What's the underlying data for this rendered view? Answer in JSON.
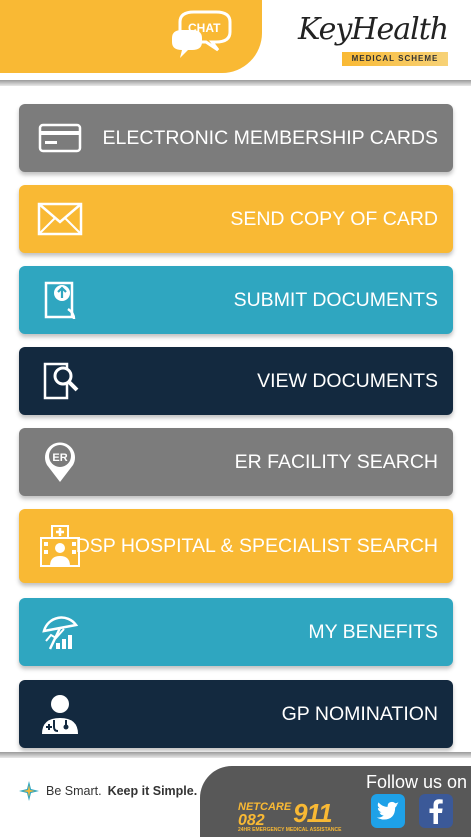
{
  "header": {
    "chat_label": "CHAT",
    "logo_title": "KeyHealth",
    "logo_subtitle": "MEDICAL SCHEME"
  },
  "menu": [
    {
      "label": "ELECTRONIC MEMBERSHIP CARDS",
      "color": "#7c7c7c",
      "icon": "card-icon"
    },
    {
      "label": "SEND COPY OF CARD",
      "color": "#f9b934",
      "icon": "envelope-icon"
    },
    {
      "label": "SUBMIT DOCUMENTS",
      "color": "#2fa6c0",
      "icon": "upload-document-icon"
    },
    {
      "label": "VIEW DOCUMENTS",
      "color": "#13293f",
      "icon": "search-document-icon"
    },
    {
      "label": "ER FACILITY SEARCH",
      "color": "#7c7c7c",
      "icon": "er-location-icon"
    },
    {
      "label": "DSP HOSPITAL & SPECIALIST SEARCH",
      "color": "#f9b934",
      "icon": "hospital-doctor-icon"
    },
    {
      "label": "MY  BENEFITS",
      "color": "#2fa6c0",
      "icon": "umbrella-benefits-icon"
    },
    {
      "label": "GP NOMINATION",
      "color": "#13293f",
      "icon": "doctor-icon"
    }
  ],
  "footer": {
    "tagline_normal": "Be Smart.",
    "tagline_bold": "Keep it Simple.",
    "netcare_brand": "NETCARE",
    "netcare_number_prefix": "082",
    "netcare_number_suffix": "911",
    "netcare_caption": "24HR EMERGENCY MEDICAL ASSISTANCE",
    "follow_label": "Follow us on"
  },
  "colors": {
    "accent": "#f9b934",
    "grey": "#7c7c7c",
    "teal": "#2fa6c0",
    "navy": "#13293f"
  }
}
